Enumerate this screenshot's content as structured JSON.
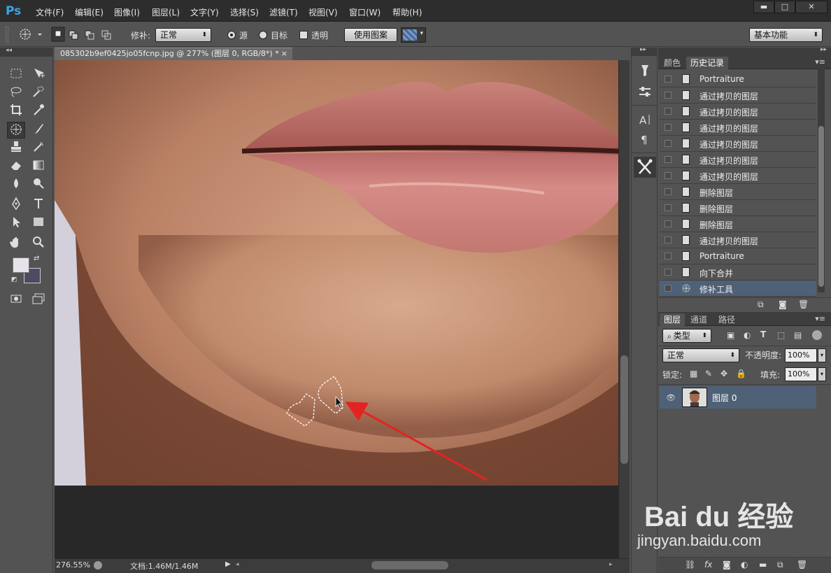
{
  "app": {
    "logo": "Ps"
  },
  "menu": [
    "文件(F)",
    "编辑(E)",
    "图像(I)",
    "图层(L)",
    "文字(Y)",
    "选择(S)",
    "滤镜(T)",
    "视图(V)",
    "窗口(W)",
    "帮助(H)"
  ],
  "window_controls": {
    "minimize": "▬",
    "maximize": "□",
    "close": "✕"
  },
  "options": {
    "patch_label": "修补:",
    "patch_mode": "正常",
    "source_label": "源",
    "target_label": "目标",
    "transparent_label": "透明",
    "use_pattern_label": "使用图案",
    "source_selected": true,
    "workspace": "基本功能"
  },
  "document": {
    "tab_title": "085302b9ef0425jo05fcnp.jpg @ 277% (图层 0, RGB/8*) *",
    "close_glyph": "×",
    "zoom": "276.55%",
    "doc_size": "文档:1.46M/1.46M"
  },
  "panels": {
    "top_tabs": [
      "颜色",
      "历史记录"
    ],
    "history_items": [
      "Portraiture",
      "通过拷贝的图层",
      "通过拷贝的图层",
      "通过拷贝的图层",
      "通过拷贝的图层",
      "通过拷贝的图层",
      "通过拷贝的图层",
      "删除图层",
      "删除图层",
      "删除图层",
      "通过拷贝的图层",
      "Portraiture",
      "向下合并",
      "修补工具"
    ],
    "current_history_index": 13,
    "layer_tabs": [
      "图层",
      "通道",
      "路径"
    ],
    "filter_label": "类型",
    "blend_mode": "正常",
    "opacity_label": "不透明度:",
    "opacity_value": "100%",
    "lock_label": "锁定:",
    "fill_label": "填充:",
    "fill_value": "100%",
    "layers": [
      {
        "name": "图层 0",
        "visible": true,
        "selected": true
      }
    ]
  },
  "watermark": {
    "brand": "Bai du 经验",
    "url": "jingyan.baidu.com"
  },
  "colors": {
    "accent": "#38a6e8",
    "arrow": "#e52222",
    "selected_row": "#4f6177"
  }
}
